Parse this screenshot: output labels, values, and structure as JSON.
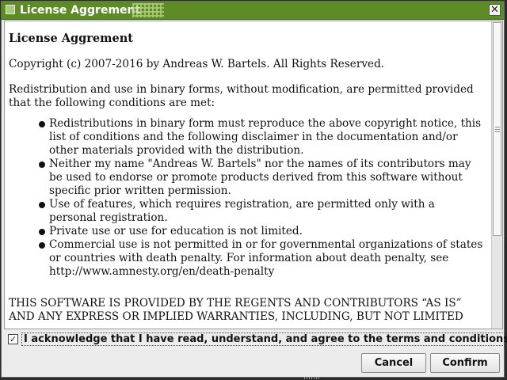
{
  "window": {
    "title": "License Aggrement",
    "close_glyph": "✕",
    "icon": "window-app-icon"
  },
  "document": {
    "heading": "License Aggrement",
    "copyright": "Copyright (c) 2007-2016 by Andreas W. Bartels. All Rights Reserved.",
    "intro": "Redistribution and use in binary forms, without modification, are permitted provided that the following conditions are met:",
    "conditions": [
      "Redistributions in binary form must reproduce the above copyright notice, this list of conditions and the following disclaimer in the documentation and/or other materials provided with the distribution.",
      "Neither my name \"Andreas W. Bartels\" nor the names of its contributors may be used to endorse or promote products derived from this software without specific prior written permission.",
      "Use of features, which requires registration, are permitted only with a personal registration.",
      "Private use or use for education is not limited.",
      "Commercial use is not permitted in or for governmental organizations of states or countries with death penalty. For information about death penalty, see http://www.amnesty.org/en/death-penalty"
    ],
    "disclaimer": "THIS SOFTWARE IS PROVIDED BY THE REGENTS AND CONTRIBUTORS “AS IS” AND ANY EXPRESS OR IMPLIED WARRANTIES, INCLUDING, BUT NOT LIMITED"
  },
  "agreement": {
    "checked": true,
    "check_glyph": "✓",
    "label": "I acknowledge that I have read, understand, and agree to the terms and conditions."
  },
  "buttons": {
    "cancel": "Cancel",
    "confirm": "Confirm"
  },
  "colors": {
    "titlebar": "#5d8c26",
    "window_bg": "#ececec"
  }
}
